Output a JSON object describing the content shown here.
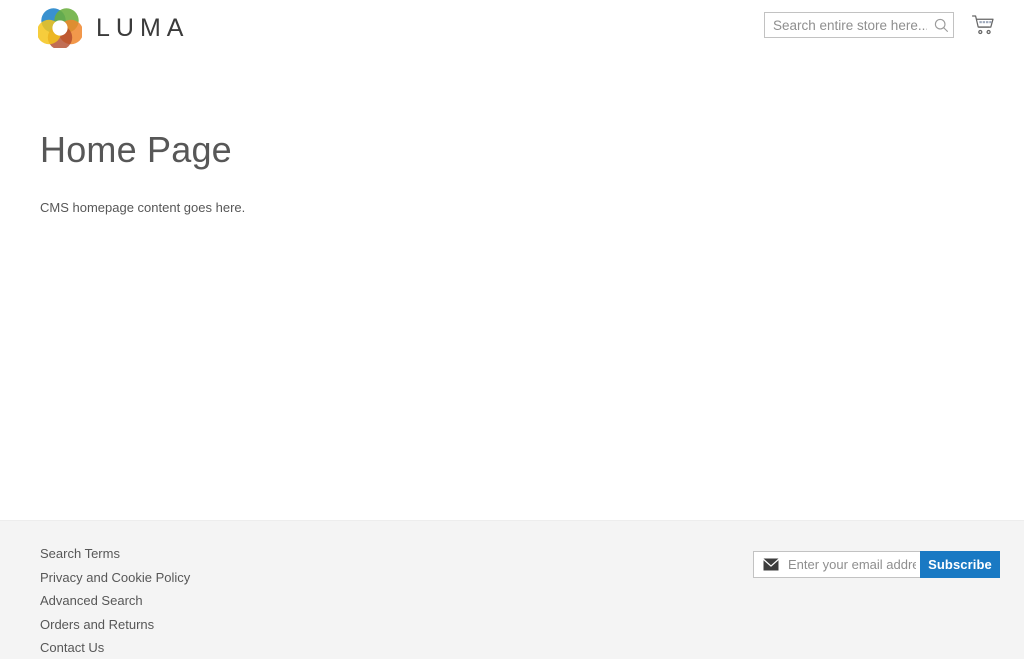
{
  "header": {
    "logo": {
      "brand_name": "LUMA",
      "icon": "luma-flower-logo",
      "colors": {
        "blue": "#1e82c8",
        "green": "#6aae3d",
        "orange": "#f0862b",
        "red_brown": "#b14a2a",
        "yellow": "#f4c41a"
      }
    },
    "search": {
      "placeholder": "Search entire store here...",
      "value": "",
      "icon": "search-icon"
    },
    "cart": {
      "icon": "shopping-cart-icon",
      "label": "My Cart"
    }
  },
  "main": {
    "page_title": "Home Page",
    "cms_content": "CMS homepage content goes here."
  },
  "footer": {
    "links": [
      {
        "label": "Search Terms"
      },
      {
        "label": "Privacy and Cookie Policy"
      },
      {
        "label": "Advanced Search"
      },
      {
        "label": "Orders and Returns"
      },
      {
        "label": "Contact Us"
      }
    ],
    "newsletter": {
      "icon": "envelope-icon",
      "placeholder": "Enter your email address",
      "value": "",
      "subscribe_label": "Subscribe",
      "accent_color": "#1979c3"
    }
  }
}
